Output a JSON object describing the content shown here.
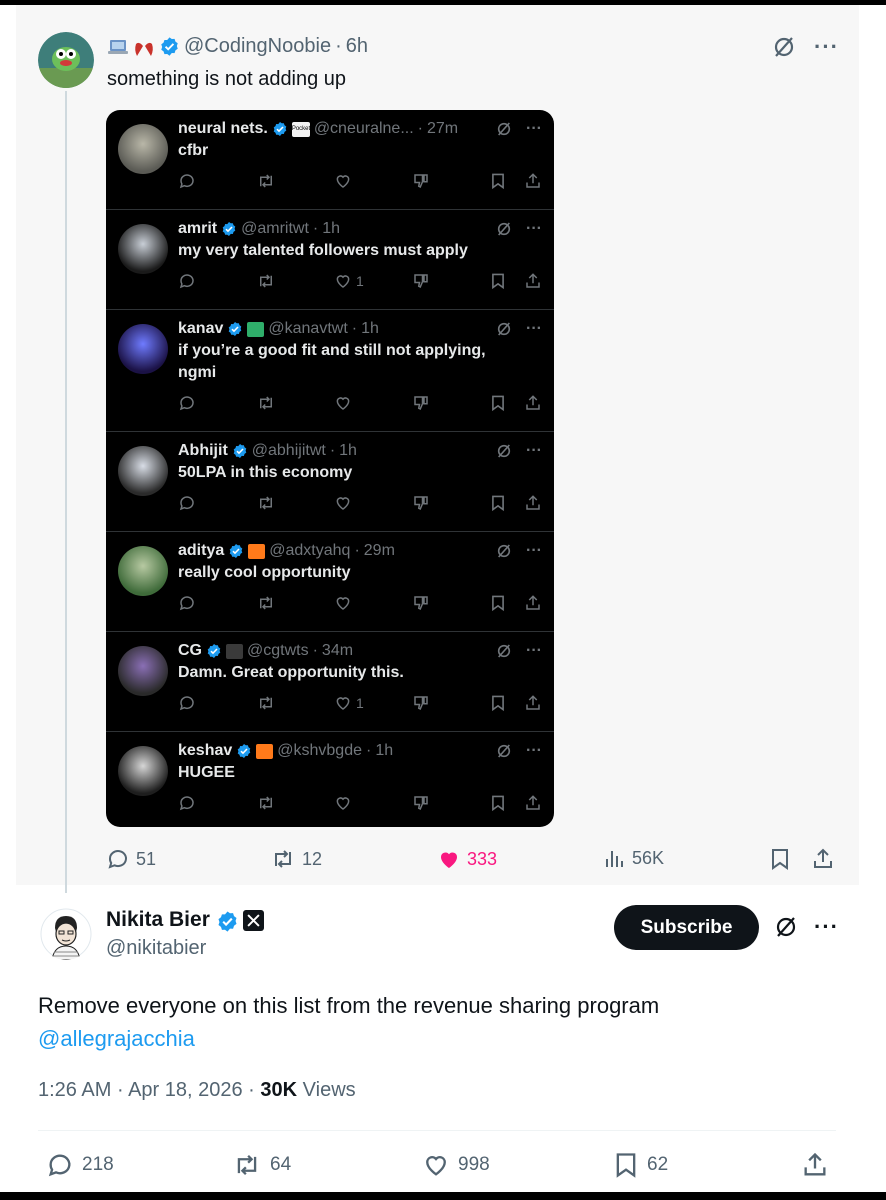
{
  "quoted_post": {
    "author_handle": "@CodingNoobie",
    "time": "6h",
    "text": "something is not adding up",
    "embedded_screenshot": {
      "replies": [
        {
          "name": "neural nets.",
          "badge": "Pocket",
          "handle": "@cneuralne...",
          "time": "27m",
          "text": "cfbr",
          "likes": ""
        },
        {
          "name": "amrit",
          "badge": "",
          "handle": "@amritwt",
          "time": "1h",
          "text": "my very talented followers must apply",
          "likes": "1"
        },
        {
          "name": "kanav",
          "badge": "",
          "handle": "@kanavtwt",
          "time": "1h",
          "text": "if you’re a good fit and still not applying, ngmi",
          "likes": ""
        },
        {
          "name": "Abhijit",
          "badge": "",
          "handle": "@abhijitwt",
          "time": "1h",
          "text": "50LPA in this economy",
          "likes": ""
        },
        {
          "name": "aditya",
          "badge": "",
          "handle": "@adxtyahq",
          "time": "29m",
          "text": "really cool opportunity",
          "likes": ""
        },
        {
          "name": "CG",
          "badge": "",
          "handle": "@cgtwts",
          "time": "34m",
          "text": "Damn. Great opportunity this.",
          "likes": "1"
        },
        {
          "name": "keshav",
          "badge": "",
          "handle": "@kshvbgde",
          "time": "1h",
          "text": "HUGEE",
          "likes": ""
        }
      ]
    },
    "stats": {
      "replies": "51",
      "reposts": "12",
      "likes": "333",
      "views": "56K"
    }
  },
  "post": {
    "author_name": "Nikita Bier",
    "author_handle": "@nikitabier",
    "subscribe_label": "Subscribe",
    "text": "Remove everyone on this list from the revenue sharing program",
    "mention": "@allegrajacchia",
    "time": "1:26 AM",
    "date": "Apr 18, 2026",
    "views_count": "30K",
    "views_label": "Views",
    "stats": {
      "replies": "218",
      "reposts": "64",
      "likes": "998",
      "bookmarks": "62"
    }
  },
  "colors": {
    "accent": "#1d9bf0",
    "like_active": "#f91880",
    "verified": "#1d9bf0"
  }
}
